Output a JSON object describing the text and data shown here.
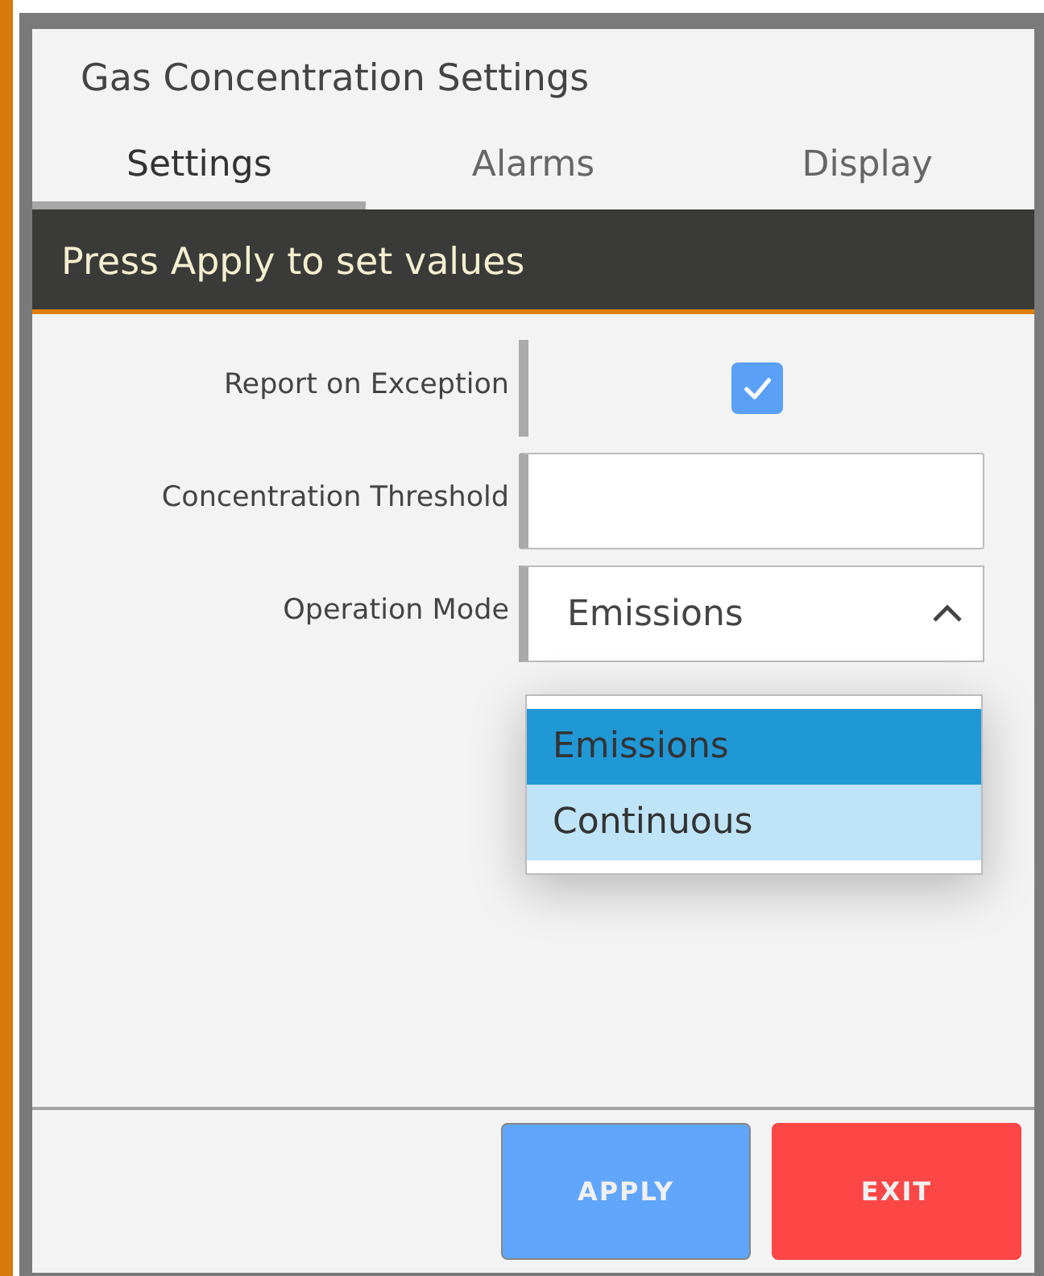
{
  "dialog": {
    "title": "Gas Concentration Settings"
  },
  "tabs": [
    {
      "label": "Settings",
      "selected": true
    },
    {
      "label": "Alarms",
      "selected": false
    },
    {
      "label": "Display",
      "selected": false
    }
  ],
  "banner": "Press Apply to set values",
  "fields": [
    {
      "kind": "checkbox",
      "label": "Report on Exception",
      "checked": true
    },
    {
      "kind": "text",
      "label": "Concentration Threshold"
    },
    {
      "kind": "select",
      "label": "Operation Mode",
      "value": "Emissions",
      "expanded": true,
      "options": [
        {
          "label": "Emissions",
          "selected": true
        },
        {
          "label": "Continuous",
          "selected": false
        }
      ]
    }
  ],
  "buttons": [
    {
      "label": "APPLY",
      "kind": "primary"
    },
    {
      "label": "EXIT",
      "kind": "danger"
    }
  ]
}
